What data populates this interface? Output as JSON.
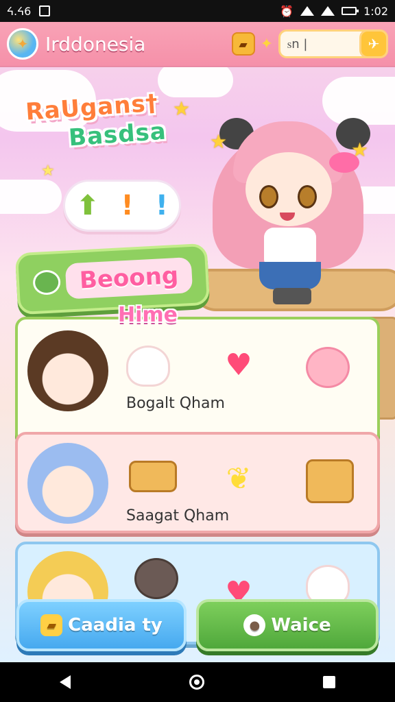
{
  "status_bar": {
    "left_text": "ᔦ.ᔦ6",
    "time": "1:02"
  },
  "header": {
    "title": "Irddonesia",
    "search_value": "ꮪn |"
  },
  "logo": {
    "line1": "RaUgans†",
    "line2": "Basdsa"
  },
  "banner": {
    "label": "Beoong"
  },
  "cards": [
    {
      "title": "Hime",
      "label": "Bogalt Qham"
    },
    {
      "label": "Saagat Qham"
    }
  ],
  "buttons": {
    "left": "Caadia ty",
    "right": "Waice"
  },
  "colors": {
    "topbar": "#f590a9",
    "accent_green": "#4fa83b",
    "accent_blue": "#46a9ef"
  }
}
